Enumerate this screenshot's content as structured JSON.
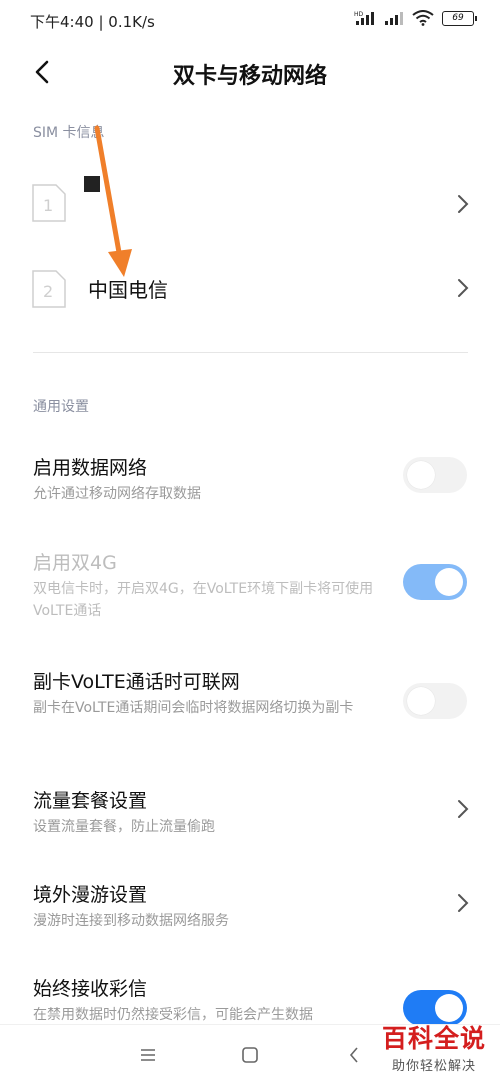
{
  "status_bar": {
    "time": "下午4:40 | 0.1K/s",
    "battery": "69",
    "icons": [
      "hd-signal-icon",
      "signal-icon",
      "wifi-icon",
      "battery-icon"
    ]
  },
  "header": {
    "title": "双卡与移动网络",
    "back_icon": "chevron-left-icon"
  },
  "sim_section": {
    "label": "SIM 卡信息",
    "cards": [
      {
        "slot": "1",
        "name": ""
      },
      {
        "slot": "2",
        "name": "中国电信"
      }
    ]
  },
  "general_section": {
    "label": "通用设置"
  },
  "settings": [
    {
      "title": "启用数据网络",
      "desc": "允许通过移动网络存取数据",
      "control": "toggle",
      "state": "off"
    },
    {
      "title": "启用双4G",
      "desc": "双电信卡时，开启双4G，在VoLTE环境下副卡将可使用VoLTE通话",
      "control": "toggle",
      "state": "on",
      "disabled": true
    },
    {
      "title": "副卡VoLTE通话时可联网",
      "desc": "副卡在VoLTE通话期间会临时将数据网络切换为副卡",
      "control": "toggle",
      "state": "off"
    },
    {
      "title": "流量套餐设置",
      "desc": "设置流量套餐，防止流量偷跑",
      "control": "chevron"
    },
    {
      "title": "境外漫游设置",
      "desc": "漫游时连接到移动数据网络服务",
      "control": "chevron"
    },
    {
      "title": "始终接收彩信",
      "desc": "在禁用数据时仍然接受彩信，可能会产生数据",
      "control": "toggle",
      "state": "on"
    }
  ],
  "nav_bar": {
    "icons": [
      "menu-icon",
      "home-icon",
      "back-icon"
    ]
  },
  "watermark": {
    "title": "百科全说",
    "subtitle": "助你轻松解决"
  },
  "colors": {
    "accent": "#1f7cf5",
    "accent_disabled": "#84baf8",
    "annotation_arrow": "#f07f2a",
    "watermark_red": "#d41e1e"
  }
}
